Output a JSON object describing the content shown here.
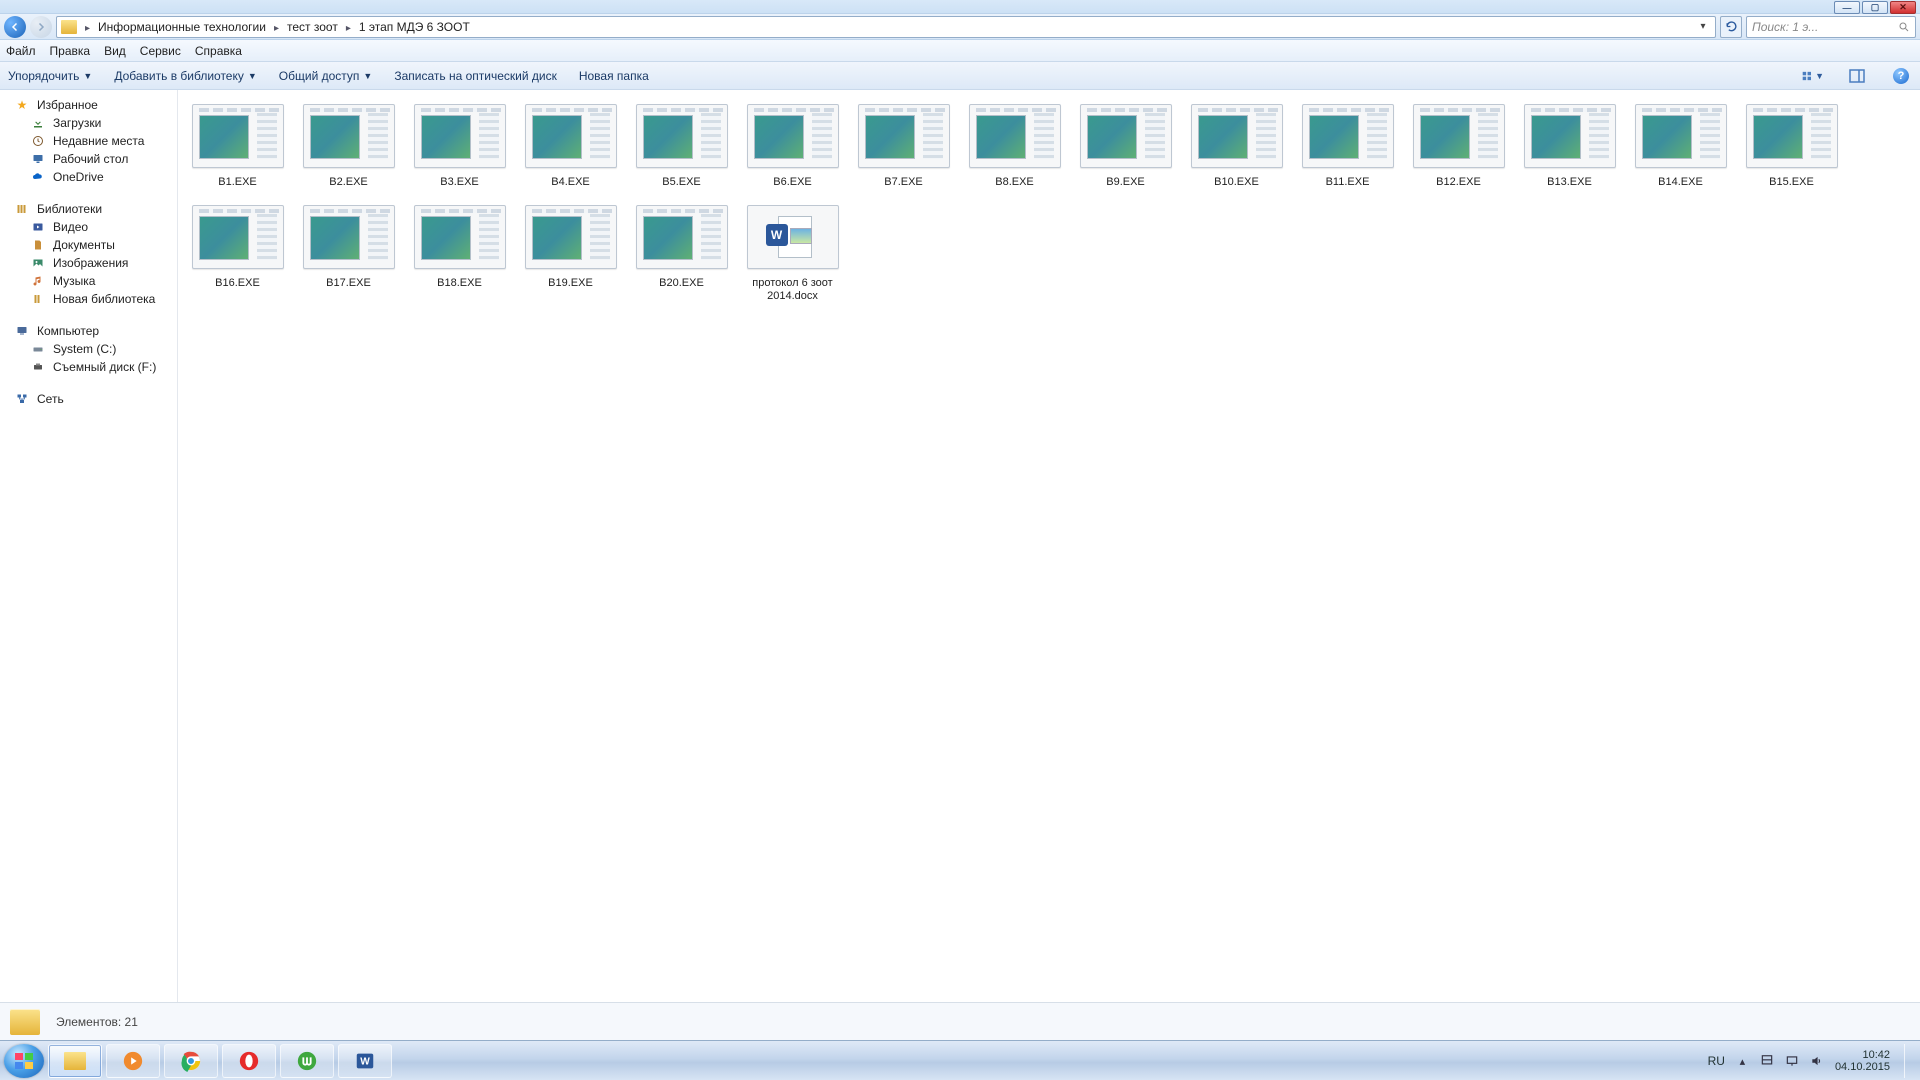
{
  "breadcrumb": [
    "Информационные технологии",
    "тест зоот",
    "1 этап МДЭ 6 ЗООТ"
  ],
  "search_placeholder": "Поиск: 1 э...",
  "menu": {
    "file": "Файл",
    "edit": "Правка",
    "view": "Вид",
    "service": "Сервис",
    "help": "Справка"
  },
  "toolbar": {
    "organize": "Упорядочить",
    "add_to_library": "Добавить в библиотеку",
    "shared_access": "Общий доступ",
    "burn": "Записать на оптический диск",
    "new_folder": "Новая папка"
  },
  "sidebar": {
    "favorites": {
      "label": "Избранное",
      "items": [
        {
          "label": "Загрузки"
        },
        {
          "label": "Недавние места"
        },
        {
          "label": "Рабочий стол"
        },
        {
          "label": "OneDrive"
        }
      ]
    },
    "libraries": {
      "label": "Библиотеки",
      "items": [
        {
          "label": "Видео"
        },
        {
          "label": "Документы"
        },
        {
          "label": "Изображения"
        },
        {
          "label": "Музыка"
        },
        {
          "label": "Новая библиотека"
        }
      ]
    },
    "computer": {
      "label": "Компьютер",
      "items": [
        {
          "label": "System (C:)"
        },
        {
          "label": "Съемный диск (F:)"
        }
      ]
    },
    "network": {
      "label": "Сеть"
    }
  },
  "files": [
    {
      "name": "В1.EXE",
      "type": "exe"
    },
    {
      "name": "В2.EXE",
      "type": "exe"
    },
    {
      "name": "В3.EXE",
      "type": "exe"
    },
    {
      "name": "В4.EXE",
      "type": "exe"
    },
    {
      "name": "В5.EXE",
      "type": "exe"
    },
    {
      "name": "В6.EXE",
      "type": "exe"
    },
    {
      "name": "В7.EXE",
      "type": "exe"
    },
    {
      "name": "В8.EXE",
      "type": "exe"
    },
    {
      "name": "В9.EXE",
      "type": "exe"
    },
    {
      "name": "В10.EXE",
      "type": "exe"
    },
    {
      "name": "В11.EXE",
      "type": "exe"
    },
    {
      "name": "В12.EXE",
      "type": "exe"
    },
    {
      "name": "В13.EXE",
      "type": "exe"
    },
    {
      "name": "В14.EXE",
      "type": "exe"
    },
    {
      "name": "В15.EXE",
      "type": "exe"
    },
    {
      "name": "В16.EXE",
      "type": "exe"
    },
    {
      "name": "В17.EXE",
      "type": "exe"
    },
    {
      "name": "В18.EXE",
      "type": "exe"
    },
    {
      "name": "В19.EXE",
      "type": "exe"
    },
    {
      "name": "В20.EXE",
      "type": "exe"
    },
    {
      "name": "протокол 6 зоот 2014.docx",
      "type": "docx"
    }
  ],
  "status": {
    "items_label": "Элементов:",
    "items_count": "21"
  },
  "tray": {
    "lang": "RU",
    "time": "10:42",
    "date": "04.10.2015"
  }
}
